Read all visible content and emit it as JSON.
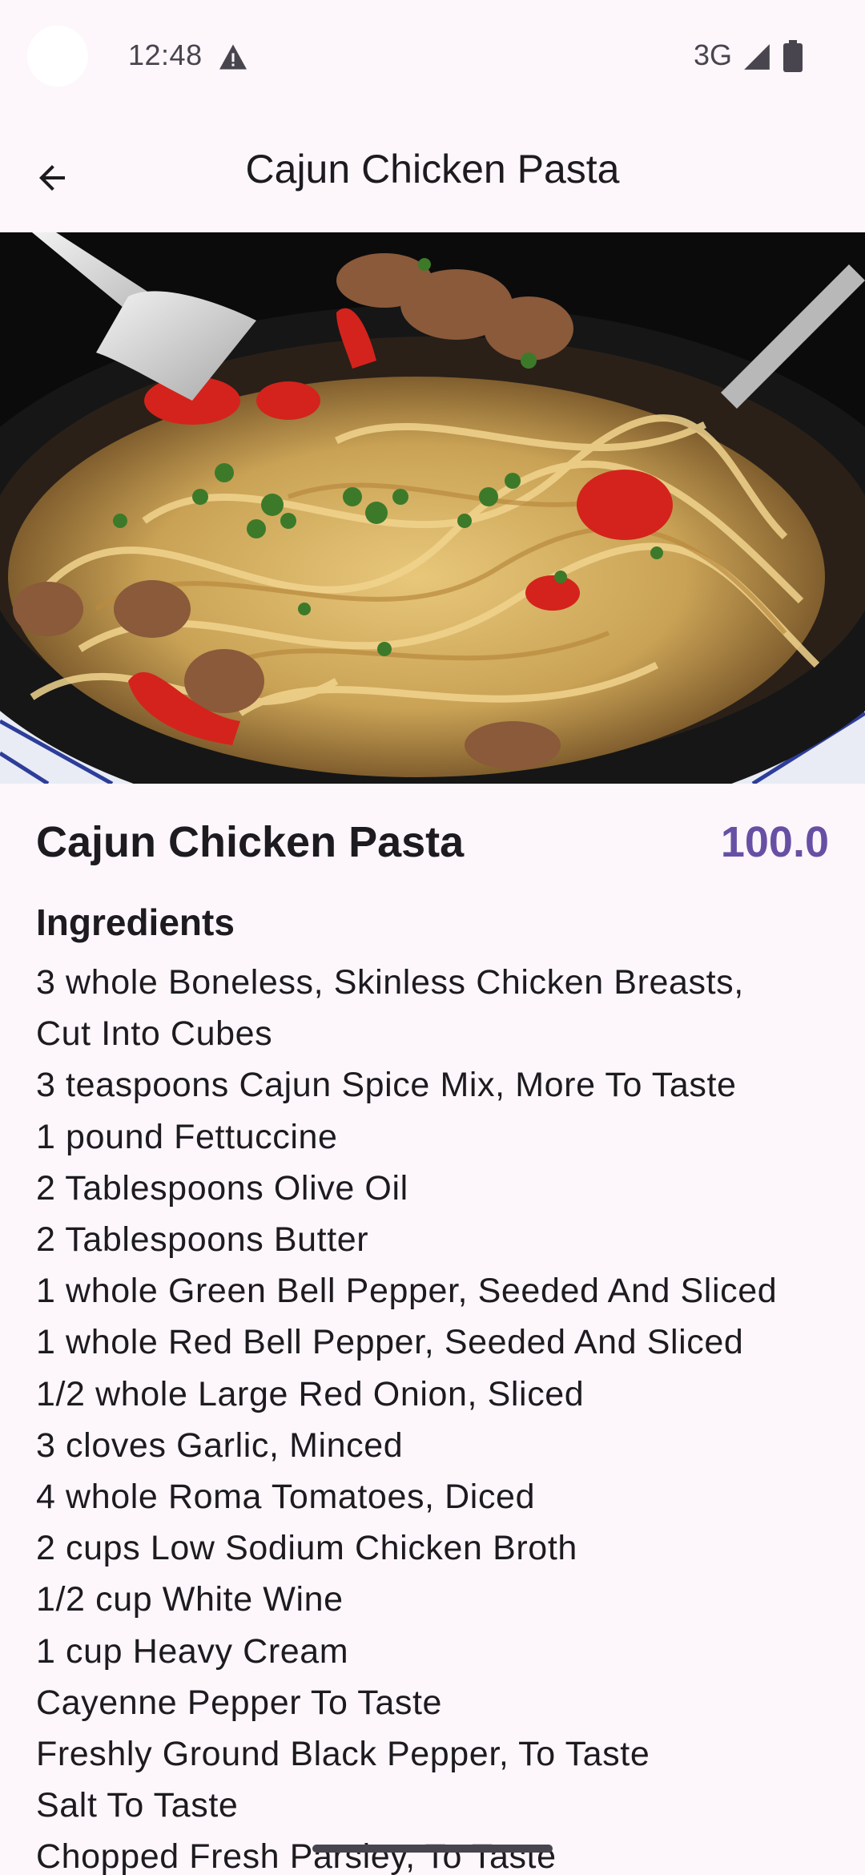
{
  "status_bar": {
    "time": "12:48",
    "network": "3G",
    "icons": [
      "warning-icon",
      "signal-icon",
      "battery-icon"
    ]
  },
  "app_bar": {
    "title": "Cajun Chicken Pasta",
    "back_icon": "arrow-back-icon"
  },
  "recipe": {
    "name": "Cajun Chicken Pasta",
    "price": "100.0",
    "ingredients_heading": "Ingredients",
    "ingredients": [
      "3 whole Boneless, Skinless Chicken Breasts,",
      "Cut Into Cubes",
      "3 teaspoons Cajun Spice Mix, More To Taste",
      "1 pound Fettuccine",
      "2 Tablespoons Olive Oil",
      "2 Tablespoons Butter",
      "1 whole Green Bell Pepper, Seeded And Sliced",
      "1 whole Red Bell Pepper, Seeded And Sliced",
      "1/2 whole Large Red Onion, Sliced",
      "3 cloves Garlic, Minced",
      "4 whole Roma Tomatoes, Diced",
      "2 cups Low Sodium Chicken Broth",
      "1/2 cup White Wine",
      "1 cup Heavy Cream",
      "Cayenne Pepper To Taste",
      "Freshly Ground Black Pepper, To Taste",
      "Salt To Taste",
      "Chopped Fresh Parsley, To Taste"
    ]
  },
  "colors": {
    "background": "#fdf7fb",
    "accent": "#6750a4",
    "text": "#1d1b20"
  }
}
